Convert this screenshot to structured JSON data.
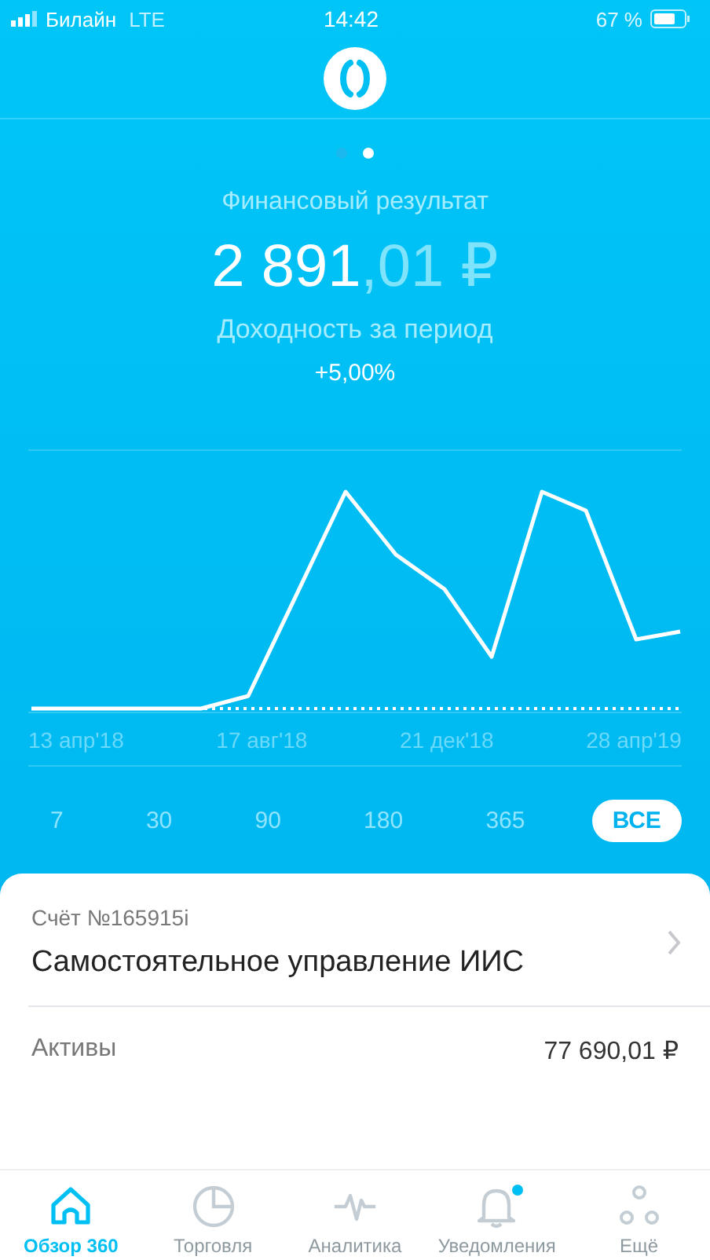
{
  "status_bar": {
    "carrier": "Билайн",
    "network": "LTE",
    "time": "14:42",
    "battery": "67 %"
  },
  "pager": [
    {
      "selected": false
    },
    {
      "selected": true
    }
  ],
  "summary": {
    "title": "Финансовый результат",
    "amount_whole": "2 891",
    "amount_fraction": ",01 ₽",
    "yield_label": "Доходность за период",
    "yield_value": "+5,00%"
  },
  "chart": {
    "dates": [
      "13 апр'18",
      "17 авг'18",
      "21 дек'18",
      "28 апр'19"
    ]
  },
  "periods": [
    {
      "label": "7",
      "selected": false
    },
    {
      "label": "30",
      "selected": false
    },
    {
      "label": "90",
      "selected": false
    },
    {
      "label": "180",
      "selected": false
    },
    {
      "label": "365",
      "selected": false
    },
    {
      "label": "ВСЕ",
      "selected": true
    }
  ],
  "account": {
    "number": "Счёт №165915i",
    "name": "Самостоятельное управление ИИС",
    "assets_label": "Активы",
    "assets_value": "77 690,01 ₽"
  },
  "nav": [
    {
      "kind": "home",
      "label": "Обзор 360",
      "selected": true,
      "badge": false
    },
    {
      "kind": "pie",
      "label": "Торговля",
      "selected": false,
      "badge": false
    },
    {
      "kind": "pulse",
      "label": "Аналитика",
      "selected": false,
      "badge": false
    },
    {
      "kind": "bell",
      "label": "Уведомления",
      "selected": false,
      "badge": true
    },
    {
      "kind": "dots",
      "label": "Ещё",
      "selected": false,
      "badge": false
    }
  ]
}
